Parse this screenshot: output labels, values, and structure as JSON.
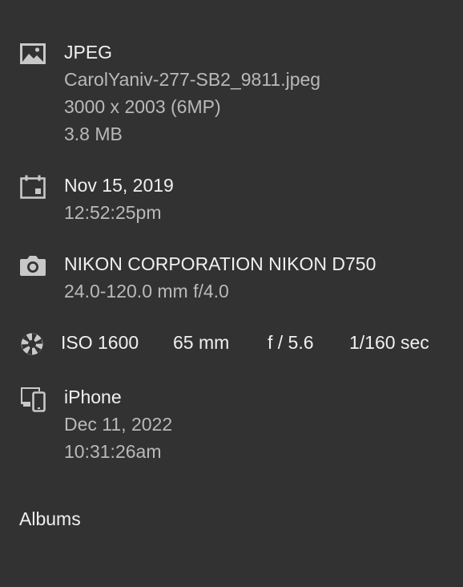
{
  "file": {
    "format": "JPEG",
    "filename": "CarolYaniv-277-SB2_9811.jpeg",
    "dimensions": "3000 x 2003 (6MP)",
    "size": "3.8 MB",
    "icon": "image-icon"
  },
  "capture": {
    "date": "Nov 15, 2019",
    "time": "12:52:25pm",
    "icon": "calendar-icon"
  },
  "camera": {
    "model": "NIKON CORPORATION NIKON D750",
    "lens": "24.0-120.0 mm f/4.0",
    "icon": "camera-icon"
  },
  "exif": {
    "iso": "ISO 1600",
    "focal_length": "65 mm",
    "aperture": "f / 5.6",
    "shutter": "1/160 sec",
    "icon": "aperture-icon"
  },
  "import": {
    "device": "iPhone",
    "date": "Dec 11, 2022",
    "time": "10:31:26am",
    "icon": "devices-icon"
  },
  "albums": {
    "label": "Albums"
  },
  "colors": {
    "background": "#323232",
    "primary_text": "#f0f0f0",
    "secondary_text": "#b9b9b9",
    "icon": "#c8c8c8"
  }
}
